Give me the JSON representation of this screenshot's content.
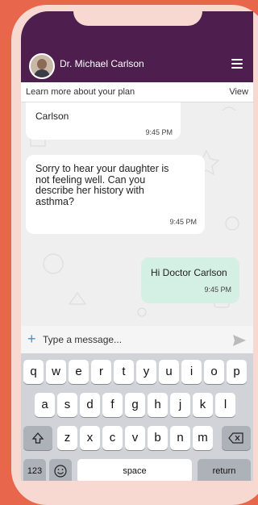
{
  "header": {
    "doctor_name": "Dr. Michael Carlson"
  },
  "plan_bar": {
    "text": "Learn more about your plan",
    "action": "View"
  },
  "messages": [
    {
      "direction": "incoming",
      "text": "Carlson",
      "time": "9:45 PM"
    },
    {
      "direction": "incoming",
      "text": "Sorry to hear your daughter is not feeling well. Can you describe her history with asthma?",
      "time": "9:45 PM"
    },
    {
      "direction": "outgoing",
      "text": "Hi Doctor Carlson",
      "time": "9:45 PM"
    }
  ],
  "composer": {
    "placeholder": "Type a message..."
  },
  "keyboard": {
    "row1": [
      "q",
      "w",
      "e",
      "r",
      "t",
      "y",
      "u",
      "i",
      "o",
      "p"
    ],
    "row2": [
      "a",
      "s",
      "d",
      "f",
      "g",
      "h",
      "j",
      "k",
      "l"
    ],
    "row3": [
      "z",
      "x",
      "c",
      "v",
      "b",
      "n",
      "m"
    ],
    "numbers": "123",
    "space": "space",
    "return": "return"
  },
  "colors": {
    "header": "#4E1F4E",
    "outgoing_bubble": "#D4EFE4",
    "background": "#E8674C",
    "accent": "#4A90C8"
  }
}
